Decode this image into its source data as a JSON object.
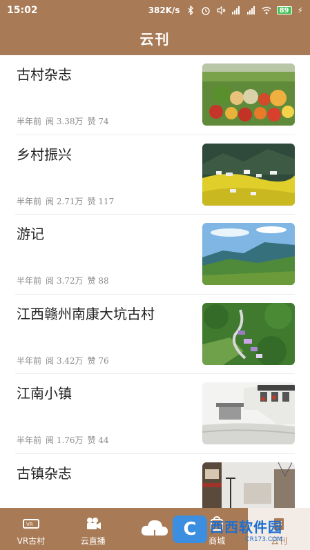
{
  "status": {
    "time": "15:02",
    "speed": "382K/s",
    "battery": "89"
  },
  "header": {
    "title": "云刊"
  },
  "articles": [
    {
      "title": "古村杂志",
      "age": "半年前",
      "reads": "阅 3.38万",
      "likes": "赞 74",
      "image": "vegetables-market"
    },
    {
      "title": "乡村振兴",
      "age": "半年前",
      "reads": "阅 2.71万",
      "likes": "赞 117",
      "image": "rapeseed-village"
    },
    {
      "title": "游记",
      "age": "半年前",
      "reads": "阅 3.72万",
      "likes": "赞 88",
      "image": "mountain-valley"
    },
    {
      "title": "江西赣州南康大坑古村",
      "age": "半年前",
      "reads": "阅 3.42万",
      "likes": "赞 76",
      "image": "aerial-village"
    },
    {
      "title": "江南小镇",
      "age": "半年前",
      "reads": "阅 1.76万",
      "likes": "赞 44",
      "image": "ink-water-town"
    },
    {
      "title": "古镇杂志",
      "age": "",
      "reads": "",
      "likes": "",
      "image": "ancient-town-street"
    }
  ],
  "tabs": [
    {
      "label": "VR古村",
      "icon": "vr-glasses-icon"
    },
    {
      "label": "云直播",
      "icon": "video-camera-icon"
    },
    {
      "label": "",
      "icon": "cloud-home-icon"
    },
    {
      "label": "商城",
      "icon": "shop-icon"
    },
    {
      "label": "云刊",
      "icon": "magazine-icon"
    }
  ],
  "watermark": {
    "name": "西西软件园",
    "domain": "CR173.COM"
  },
  "colors": {
    "brand": "#a87a55",
    "active_tab_bg": "#f3ece6"
  }
}
